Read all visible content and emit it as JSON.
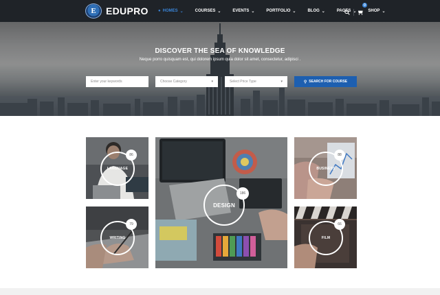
{
  "brand": {
    "name": "EDUPRO",
    "badge_letter": "E"
  },
  "nav": {
    "items": [
      {
        "label": "Homes",
        "active": true
      },
      {
        "label": "Courses",
        "active": false
      },
      {
        "label": "Events",
        "active": false
      },
      {
        "label": "Portfolio",
        "active": false
      },
      {
        "label": "Blog",
        "active": false
      },
      {
        "label": "Pages",
        "active": false
      },
      {
        "label": "Shop",
        "active": false
      }
    ],
    "cart_count": "0",
    "icons": {
      "search": "search-icon",
      "cart": "cart-icon",
      "dropdown": "chevron-down-icon"
    }
  },
  "hero": {
    "title": "DISCOVER THE SEA OF KNOWLEDGE",
    "subtitle": "Neque porro quisquam est, qui dolorem ipsum quia dolor sit amet, consectetur, adipisci .",
    "keyword_placeholder": "Enter your keywords",
    "category_select": "Choose Category",
    "price_select": "Select Price Type",
    "search_button": "Search for course"
  },
  "categories": [
    {
      "name": "LANGUAGE",
      "count": "86"
    },
    {
      "name": "WRITING",
      "count": "79"
    },
    {
      "name": "DESIGN",
      "count": "186"
    },
    {
      "name": "BUSINESS",
      "count": "88"
    },
    {
      "name": "FILM",
      "count": "66"
    }
  ],
  "colors": {
    "accent": "#1d5fb0",
    "nav_bg": "#1f2328",
    "active_nav": "#3a84d6"
  }
}
